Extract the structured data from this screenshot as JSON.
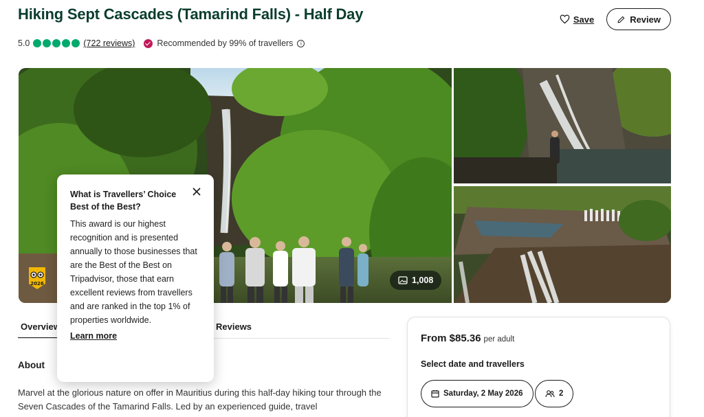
{
  "header": {
    "title": "Hiking Sept Cascades (Tamarind Falls) - Half Day",
    "save_label": "Save",
    "review_label": "Review"
  },
  "rating": {
    "score": "5.0",
    "bubbles_filled": 5,
    "reviews_link": "(722 reviews)",
    "recommended": "Recommended by 99% of travellers",
    "info_glyph": "i",
    "bubble_color": "#00aa6c",
    "badge_color": "#c2185b"
  },
  "gallery": {
    "photo_count": "1,008",
    "award_year": "2026"
  },
  "tabs": {
    "overview": "Overview",
    "reviews": "Reviews"
  },
  "about": {
    "heading": "About",
    "body": "Marvel at the glorious nature on offer in Mauritius during this half-day hiking tour through the Seven Cascades of the Tamarind Falls. Led by an experienced guide, travel"
  },
  "popover": {
    "title": "What is Travellers’ Choice Best of the Best?",
    "body": "This award is our highest recognition and is presented annually to those businesses that are the Best of the Best on Tripadvisor, those that earn excellent reviews from travellers and are ranked in the top 1% of properties worldwide.",
    "link": "Learn more"
  },
  "booking": {
    "price": "From $85.36",
    "per": "per adult",
    "select_label": "Select date and travellers",
    "date": "Saturday, 2 May 2026",
    "travellers": "2"
  },
  "colors": {
    "title": "#0b3d2e",
    "accent_green": "#00aa6c"
  }
}
